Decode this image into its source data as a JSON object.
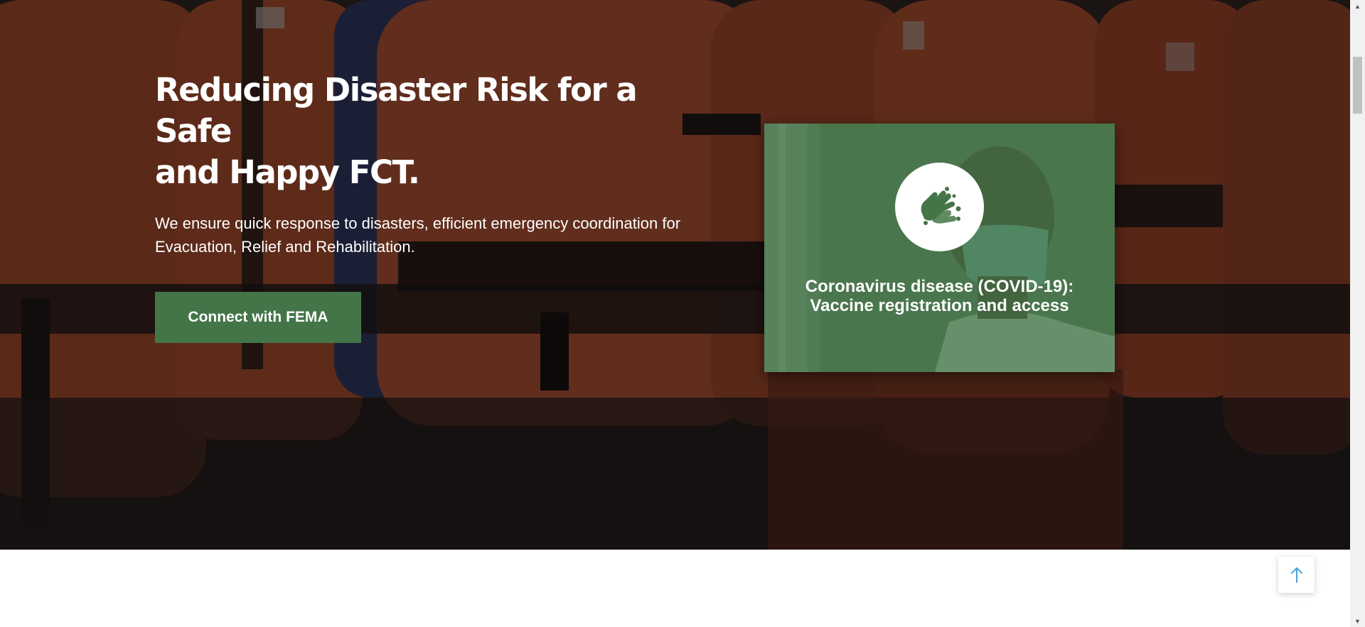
{
  "hero": {
    "title_line1": "Reducing Disaster Risk for a Safe",
    "title_line2": "and Happy FCT.",
    "description_line1": "We ensure quick response to disasters, efficient emergency coordination for",
    "description_line2": "Evacuation, Relief and Rehabilitation.",
    "cta_label": "Connect with FEMA"
  },
  "covid_card": {
    "icon": "hand-washing-icon",
    "line1": "Coronavirus disease (COVID-19):",
    "line2": "Vaccine registration and access"
  },
  "back_to_top": {
    "icon": "arrow-up-icon"
  },
  "colors": {
    "brand_green": "#447548",
    "life_jacket_orange": "#c9542c",
    "overlay_dark": "#0c0a0a",
    "white": "#ffffff"
  }
}
